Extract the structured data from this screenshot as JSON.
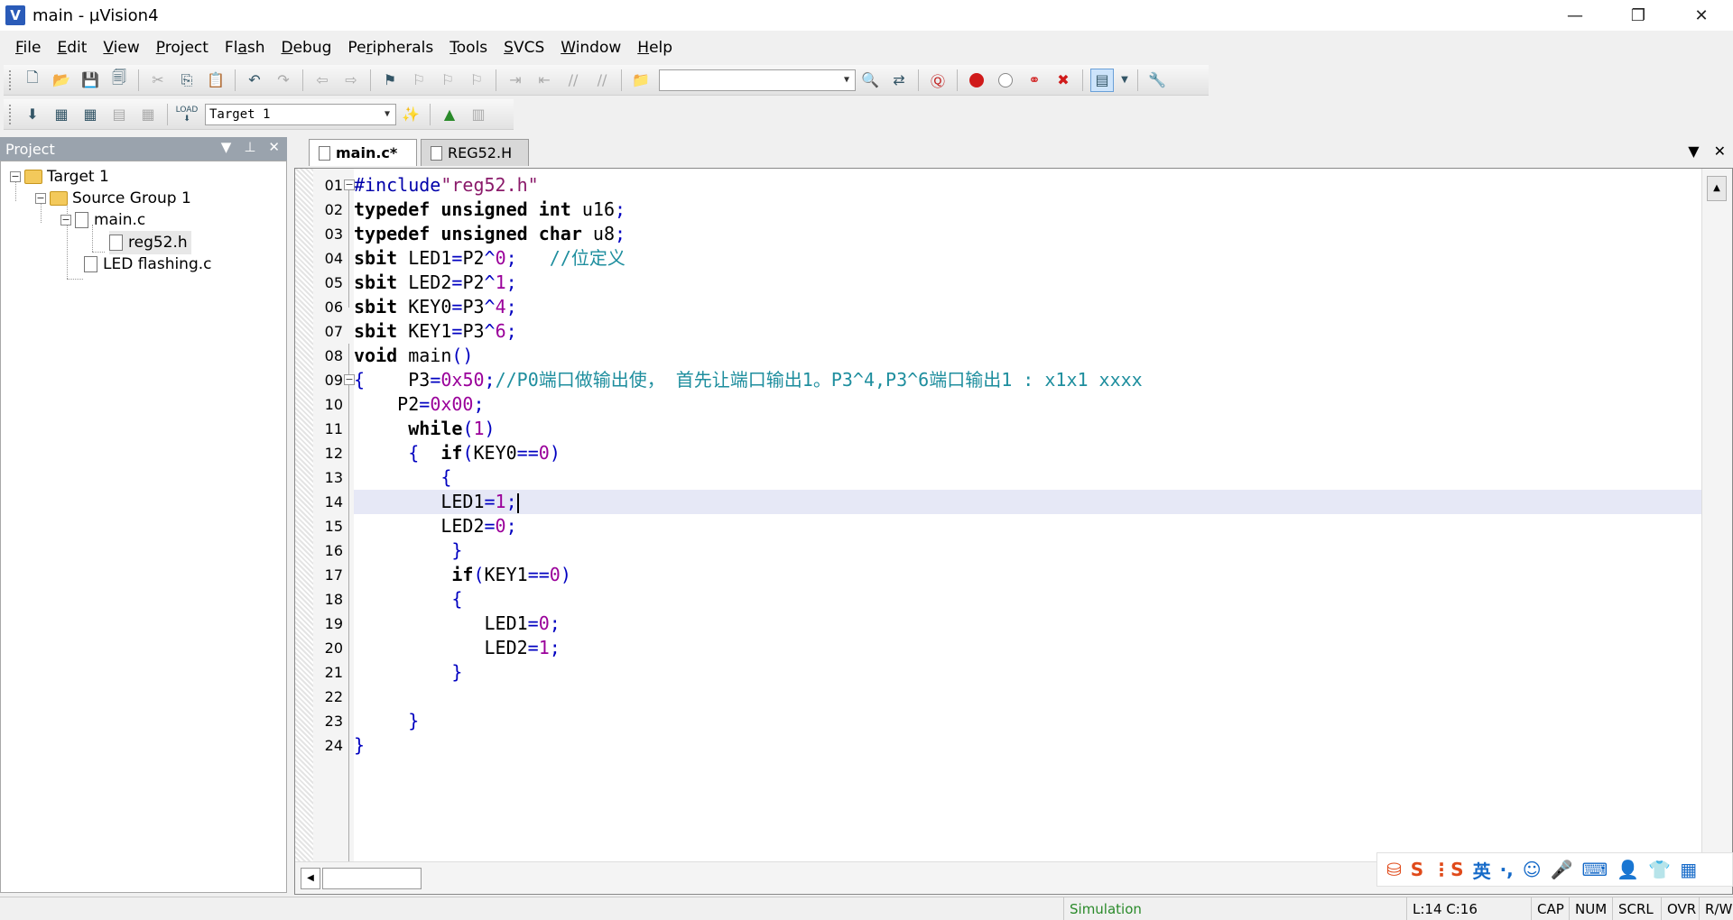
{
  "window": {
    "title": "main  - µVision4",
    "app_icon_letter": "V",
    "minimize_icon": "—",
    "restore_icon": "❐",
    "close_icon": "✕"
  },
  "menu": [
    {
      "hot": "F",
      "rest": "ile"
    },
    {
      "hot": "E",
      "rest": "dit"
    },
    {
      "hot": "V",
      "rest": "iew"
    },
    {
      "hot": "P",
      "rest": "roject"
    },
    {
      "pre": "Fl",
      "hot": "a",
      "rest": "sh"
    },
    {
      "hot": "D",
      "rest": "ebug"
    },
    {
      "pre": "Pe",
      "hot": "r",
      "rest": "ipherals"
    },
    {
      "hot": "T",
      "rest": "ools"
    },
    {
      "hot": "S",
      "rest": "VCS"
    },
    {
      "hot": "W",
      "rest": "indow"
    },
    {
      "hot": "H",
      "rest": "elp"
    }
  ],
  "toolbar2": {
    "load_label": "LOAD",
    "target_select": "Target 1"
  },
  "project": {
    "header": "Project",
    "tree": {
      "target": "Target 1",
      "group": "Source Group 1",
      "file_main": "main.c",
      "file_reg": "reg52.h",
      "file_led": "LED flashing.c"
    }
  },
  "tabs": [
    {
      "label": "main.c*",
      "active": true
    },
    {
      "label": "REG52.H",
      "active": false
    }
  ],
  "editor": {
    "line_numbers": [
      "01",
      "02",
      "03",
      "04",
      "05",
      "06",
      "07",
      "08",
      "09",
      "10",
      "11",
      "12",
      "13",
      "14",
      "15",
      "16",
      "17",
      "18",
      "19",
      "20",
      "21",
      "22",
      "23",
      "24"
    ],
    "current_line": 14
  },
  "ime": {
    "lang": "英",
    "punct": "·,"
  },
  "status": {
    "mode": "Simulation",
    "cursor": "L:14 C:16",
    "caps": "CAP",
    "num": "NUM",
    "scrl": "SCRL",
    "ovr": "OVR",
    "rw": "R/W"
  }
}
